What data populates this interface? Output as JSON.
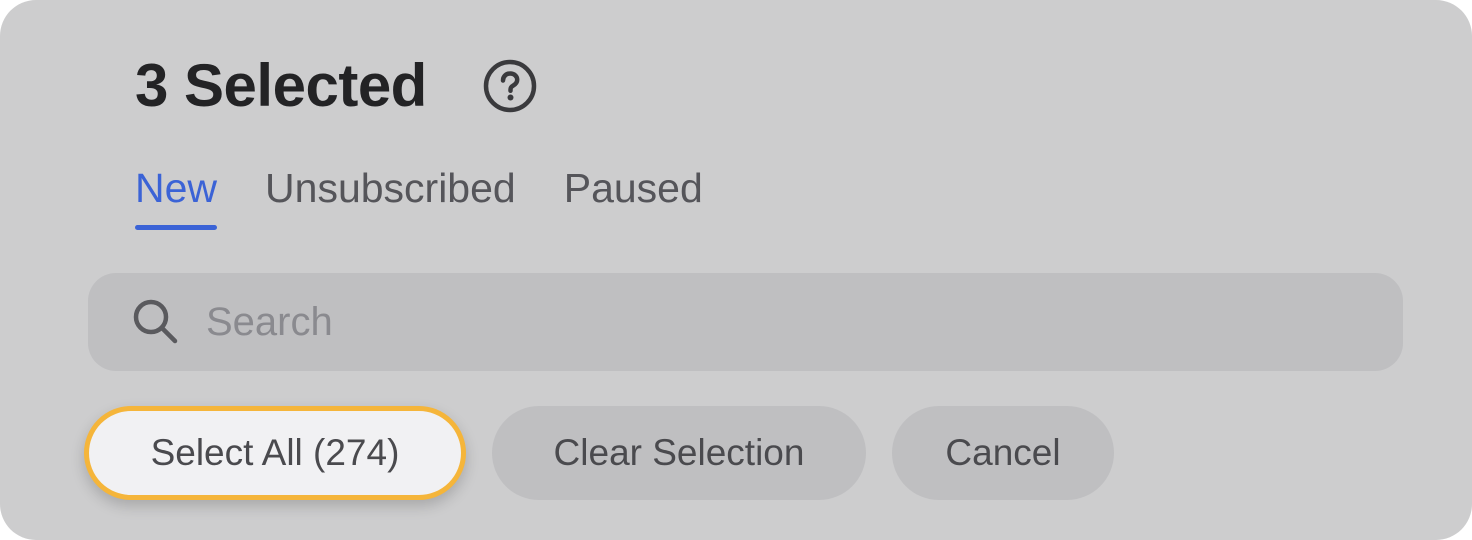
{
  "header": {
    "title": "3 Selected",
    "help_icon": "question-circle-icon"
  },
  "tabs": [
    {
      "label": "New",
      "active": true
    },
    {
      "label": "Unsubscribed",
      "active": false
    },
    {
      "label": "Paused",
      "active": false
    }
  ],
  "search": {
    "placeholder": "Search",
    "value": "",
    "icon": "search-icon"
  },
  "actions": {
    "select_all_label": "Select All (274)",
    "clear_selection_label": "Clear Selection",
    "cancel_label": "Cancel"
  },
  "colors": {
    "accent": "#3b63d6",
    "highlight": "#f5b53a",
    "panel_bg": "#cdcdce"
  }
}
